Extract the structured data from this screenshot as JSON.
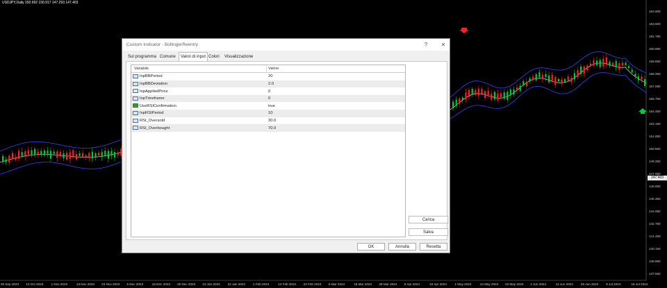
{
  "chart": {
    "symbol_title": "USDJPY,Daily  150.692 150.917 147.293 147.403",
    "current_price": "147.403",
    "price_labels": [
      "164.600",
      "163.600",
      "161.780",
      "160.950",
      "159.650",
      "158.350",
      "157.050",
      "155.750",
      "154.450",
      "153.150",
      "151.850",
      "150.550",
      "149.250",
      "147.950",
      "146.650",
      "145.350",
      "144.050",
      "142.750",
      "141.450",
      "140.150",
      "138.850",
      "137.550"
    ],
    "date_labels": [
      "28 Sep 2023",
      "10 Oct 2023",
      "1 Nov 2023",
      "13 Nov 2023",
      "23 Nov 2023",
      "5 Dec 2023",
      "15 Dec 2023",
      "28 Dec 2023",
      "10 Jan 2024",
      "22 Jan 2024",
      "1 Feb 2024",
      "13 Feb 2024",
      "23 Feb 2024",
      "6 Mar 2024",
      "18 Mar 2024",
      "28 Mar 2024",
      "9 Apr 2024",
      "19 Apr 2024",
      "1 May 2024",
      "13 May 2024",
      "23 May 2024",
      "4 Jun 2024",
      "14 Jun 2024",
      "26 Jun 2024",
      "8 Jul 2024",
      "18 Jul 2024"
    ],
    "colors": {
      "up": "#00cc33",
      "down": "#ff2020",
      "band": "#3344ff",
      "mid": "#ffffff"
    },
    "arrows": [
      {
        "type": "sell-arrow-icon",
        "color": "#ff2020"
      },
      {
        "type": "buy-arrow-icon",
        "color": "#00cc33"
      }
    ]
  },
  "dialog": {
    "title": "Custom Indicator - BollingerReentry",
    "help_label": "?",
    "close_label": "✕",
    "tabs": [
      {
        "label": "Sul programma"
      },
      {
        "label": "Comune"
      },
      {
        "label": "Valori di input"
      },
      {
        "label": "Colori"
      },
      {
        "label": "Visualizzazione"
      }
    ],
    "active_tab": "Valori di input",
    "columns": {
      "variable": "Variabile",
      "value": "Valore"
    },
    "rows": [
      {
        "icon": "123",
        "name": "InpBBPeriod",
        "value": "20"
      },
      {
        "icon": "1/2",
        "name": "InpBBDeviation",
        "value": "2.0"
      },
      {
        "icon": "123",
        "name": "InpAppliedPrice",
        "value": "0"
      },
      {
        "icon": "123",
        "name": "InpTimeframe",
        "value": "0"
      },
      {
        "icon": "flag",
        "name": "UseRSIConfirmation",
        "value": "true"
      },
      {
        "icon": "123",
        "name": "InpRSIPeriod",
        "value": "10"
      },
      {
        "icon": "1/2",
        "name": "RSI_Oversold",
        "value": "30.0"
      },
      {
        "icon": "1/2",
        "name": "RSI_Overbought",
        "value": "70.0"
      }
    ],
    "side_buttons": {
      "load": "Carica",
      "save": "Salva"
    },
    "buttons": {
      "ok": "OK",
      "cancel": "Annulla",
      "reset": "Resetta"
    }
  }
}
